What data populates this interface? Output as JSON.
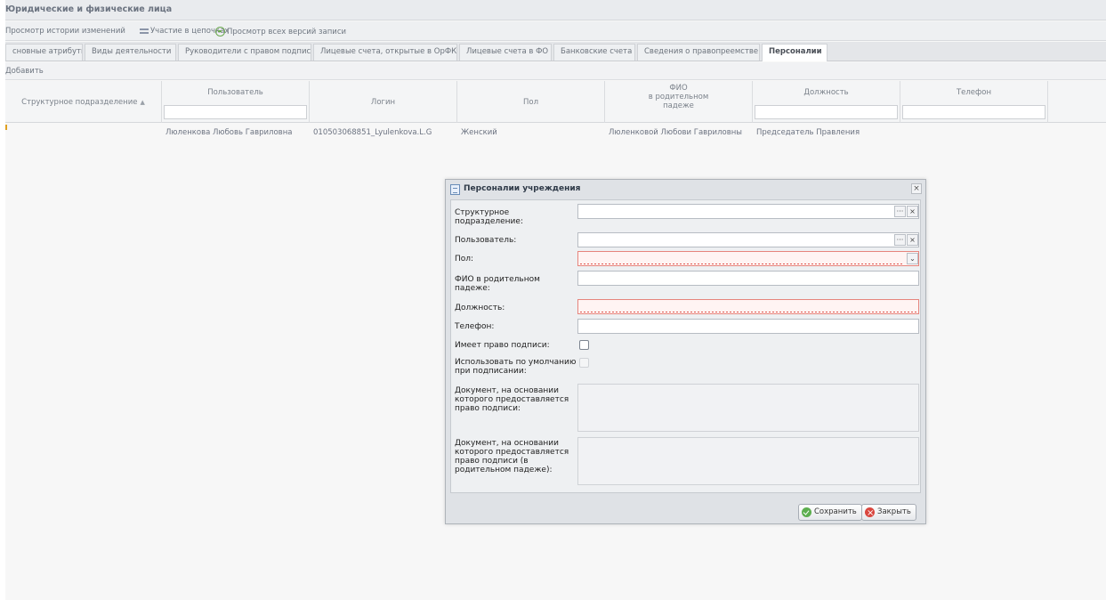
{
  "window": {
    "title": "Юридические и физические лица"
  },
  "actions": {
    "history": "Просмотр истории изменений",
    "chains": "Участие в цепочках",
    "versions": "Просмотр всех версий записи"
  },
  "tabs": [
    {
      "label": "сновные атрибуты"
    },
    {
      "label": "Виды деятельности"
    },
    {
      "label": "Руководители с правом подписи"
    },
    {
      "label": "Лицевые счета, открытые в ОрФК"
    },
    {
      "label": "Лицевые счета в ФО"
    },
    {
      "label": "Банковские счета"
    },
    {
      "label": "Сведения о правопреемстве"
    },
    {
      "label": "Персоналии"
    }
  ],
  "toolbar": {
    "add": "Добавить"
  },
  "grid": {
    "columns": {
      "subdivision": "Структурное подразделение",
      "user": "Пользователь",
      "login": "Логин",
      "gender": "Пол",
      "fio_line1": "ФИО",
      "fio_line2": "в родительном",
      "fio_line3": "падеже",
      "position": "Должность",
      "phone": "Телефон"
    },
    "rows": [
      {
        "subdivision": "",
        "user": "Люленкова Любовь Гавриловна",
        "login": "010503068851_Lyulenkova.L.G",
        "gender": "Женский",
        "fio": "Люленковой Любови Гавриловны",
        "position": "Председатель Правления",
        "phone": ""
      }
    ]
  },
  "dialog": {
    "title": "Персоналии учреждения",
    "labels": {
      "subdivision_1": "Структурное",
      "subdivision_2": "подразделение:",
      "user": "Пользователь:",
      "gender": "Пол:",
      "fio_1": "ФИО в родительном",
      "fio_2": "падеже:",
      "position": "Должность:",
      "phone": "Телефон:",
      "sign_right": "Имеет право подписи:",
      "default_1": "Использовать по умолчанию",
      "default_2": "при подписании:",
      "doc_1": "Документ, на основании",
      "doc_2": "которого предоставляется",
      "doc_3": "право подписи:",
      "docgen_1": "Документ, на основании",
      "docgen_2": "которого предоставляется",
      "docgen_3": "право подписи (в",
      "docgen_4": "родительном падеже):"
    },
    "values": {
      "subdivision": "",
      "user": "",
      "gender": "",
      "fio": "",
      "position": "",
      "phone": ""
    },
    "buttons": {
      "save": "Сохранить",
      "close": "Закрыть"
    },
    "glyphs": {
      "dots": "···",
      "clear": "×",
      "drop": "⌄",
      "close": "×"
    }
  },
  "colors": {
    "invalid_border": "#e6857d",
    "save_icon": "#5cae4e",
    "close_icon": "#d9463e"
  }
}
